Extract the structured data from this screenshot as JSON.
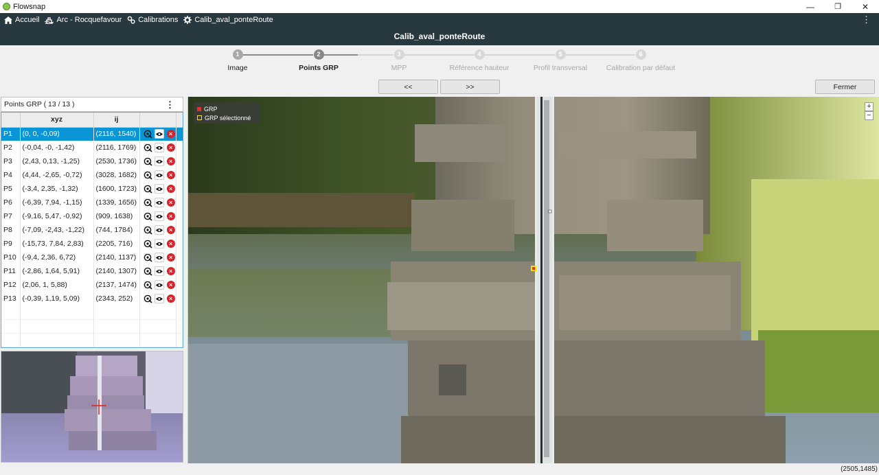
{
  "window": {
    "title": "Flowsnap",
    "controls": {
      "minimize": "—",
      "maximize": "❐",
      "close": "✕"
    }
  },
  "nav": {
    "crumbs": [
      {
        "label": "Accueil",
        "icon": "home-icon"
      },
      {
        "label": "Arc - Rocquefavour",
        "icon": "station-icon"
      },
      {
        "label": "Calibrations",
        "icon": "calibrations-icon"
      },
      {
        "label": "Calib_aval_ponteRoute",
        "icon": "gear-icon"
      }
    ],
    "menu": "⋮"
  },
  "header": {
    "title": "Calib_aval_ponteRoute"
  },
  "stepper": {
    "steps": [
      {
        "num": "1",
        "label": "Image",
        "state": "done"
      },
      {
        "num": "2",
        "label": "Points GRP",
        "state": "active"
      },
      {
        "num": "3",
        "label": "MPP",
        "state": "disabled"
      },
      {
        "num": "4",
        "label": "Référence hauteur",
        "state": "disabled"
      },
      {
        "num": "5",
        "label": "Profil transversal",
        "state": "disabled"
      },
      {
        "num": "6",
        "label": "Calibration par défaut",
        "state": "disabled"
      }
    ]
  },
  "buttons": {
    "prev": "<<",
    "next": ">>",
    "close": "Fermer"
  },
  "grp": {
    "title": "Points GRP ( 13 / 13 )",
    "menu": "⋮",
    "columns": {
      "xyz": "xyz",
      "ij": "ij"
    },
    "rows": [
      {
        "id": "P1",
        "xyz": "(0, 0, -0,09)",
        "ij": "(2116, 1540)"
      },
      {
        "id": "P2",
        "xyz": "(-0,04, -0, -1,42)",
        "ij": "(2116, 1769)"
      },
      {
        "id": "P3",
        "xyz": "(2,43, 0,13, -1,25)",
        "ij": "(2530, 1736)"
      },
      {
        "id": "P4",
        "xyz": "(4,44, -2,65, -0,72)",
        "ij": "(3028, 1682)"
      },
      {
        "id": "P5",
        "xyz": "(-3,4, 2,35, -1,32)",
        "ij": "(1600, 1723)"
      },
      {
        "id": "P6",
        "xyz": "(-6,39, 7,94, -1,15)",
        "ij": "(1339, 1656)"
      },
      {
        "id": "P7",
        "xyz": "(-9,16, 5,47, -0,92)",
        "ij": "(909, 1638)"
      },
      {
        "id": "P8",
        "xyz": "(-7,09, -2,43, -1,22)",
        "ij": "(744, 1784)"
      },
      {
        "id": "P9",
        "xyz": "(-15,73, 7,84, 2,83)",
        "ij": "(2205, 716)"
      },
      {
        "id": "P10",
        "xyz": "(-9,4, 2,36, 6,72)",
        "ij": "(2140, 1137)"
      },
      {
        "id": "P11",
        "xyz": "(-2,86, 1,64, 5,91)",
        "ij": "(2140, 1307)"
      },
      {
        "id": "P12",
        "xyz": "(2,06, 1, 5,88)",
        "ij": "(2137, 1474)"
      },
      {
        "id": "P13",
        "xyz": "(-0,39, 1,19, 5,09)",
        "ij": "(2343, 252)"
      }
    ],
    "selected": "P1"
  },
  "viewer": {
    "legend": {
      "grp": "GRP",
      "grp_selected": "GRP sélectionné"
    },
    "zoom_in": "+",
    "zoom_out": "−"
  },
  "status": {
    "coords": "(2505,1485)"
  },
  "colors": {
    "header_bg": "#28383f",
    "selection": "#0a96d6",
    "delete": "#d8232a",
    "grp_marker": "#e03030",
    "grp_selected": "#ffe000"
  }
}
